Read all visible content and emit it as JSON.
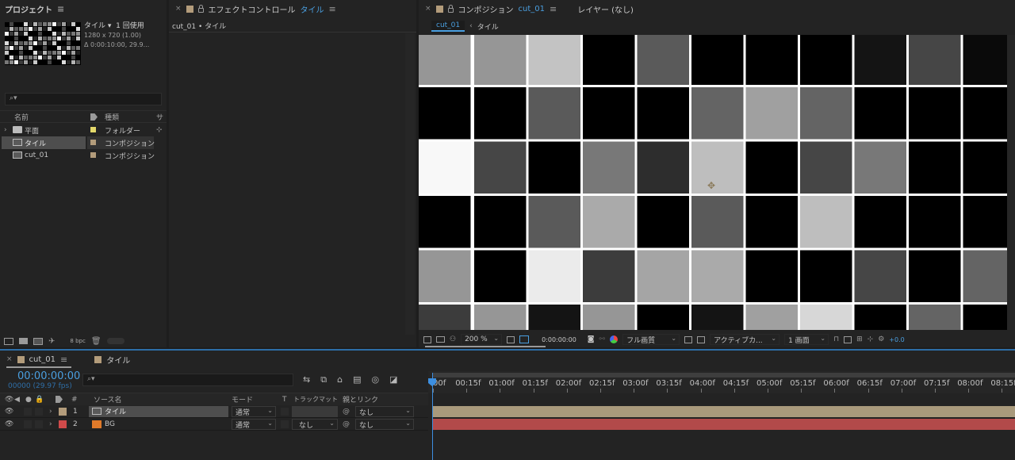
{
  "project": {
    "title": "プロジェクト",
    "item_name": "タイル ▾",
    "usage": "1 回使用",
    "resolution": "1280 x 720 (1.00)",
    "duration": "Δ 0:00:10:00, 29.9...",
    "columns": {
      "name": "名前",
      "type": "種類",
      "size": "サ"
    },
    "items": [
      {
        "name": "平面",
        "type": "フォルダー",
        "color": "#e3d86a",
        "icon": "folder-icon"
      },
      {
        "name": "タイル",
        "type": "コンポジション",
        "color": "#b39c7b",
        "icon": "composition-icon"
      },
      {
        "name": "cut_01",
        "type": "コンポジション",
        "color": "#b39c7b",
        "icon": "composition-icon"
      }
    ],
    "bpc": "8 bpc"
  },
  "effects": {
    "tab_prefix": "エフェクトコントロール",
    "tab_target": "タイル",
    "breadcrumb": "cut_01 • タイル"
  },
  "composition": {
    "tab_prefix": "コンポジション",
    "tab_target": "cut_01",
    "layer_tab": "レイヤー (なし)",
    "crumbs": [
      "cut_01",
      "タイル"
    ],
    "zoom": "200 %",
    "timecode": "0:00:00:00",
    "quality": "フル画質",
    "camera": "アクティブカ...",
    "views": "1 画面",
    "exposure": "+0.0",
    "grid_grays": [
      [
        150,
        150,
        195,
        0,
        90,
        0,
        0,
        0,
        20,
        70,
        10
      ],
      [
        0,
        0,
        90,
        0,
        0,
        100,
        160,
        100,
        0,
        0,
        0
      ],
      [
        248,
        70,
        0,
        120,
        45,
        190,
        0,
        70,
        120,
        0,
        0
      ],
      [
        0,
        0,
        90,
        170,
        0,
        90,
        0,
        190,
        0,
        0,
        0
      ],
      [
        150,
        0,
        235,
        60,
        165,
        170,
        0,
        0,
        70,
        0,
        100
      ],
      [
        60,
        150,
        20,
        150,
        0,
        20,
        160,
        215,
        0,
        100,
        0
      ]
    ]
  },
  "timeline": {
    "tabs": [
      "cut_01",
      "タイル"
    ],
    "timecode": "00:00:00:00",
    "fps": "00000 (29.97 fps)",
    "columns": {
      "source": "ソース名",
      "mode": "モード",
      "t": "T",
      "trackmatte": "トラックマット",
      "parent": "親とリンク"
    },
    "ruler": [
      "00f",
      "00:15f",
      "01:00f",
      "01:15f",
      "02:00f",
      "02:15f",
      "03:00f",
      "03:15f",
      "04:00f",
      "04:15f",
      "05:00f",
      "05:15f",
      "06:00f",
      "06:15f",
      "07:00f",
      "07:15f",
      "08:00f",
      "08:15f"
    ],
    "layers": [
      {
        "num": "1",
        "name": "タイル",
        "label_color": "#b39c7b",
        "mode": "通常",
        "trackmatte": "",
        "parent": "なし",
        "bar_color": "#a99a7c"
      },
      {
        "num": "2",
        "name": "BG",
        "label_color": "#d04a4a",
        "mode": "通常",
        "trackmatte": "なし",
        "parent": "なし",
        "bar_color": "#b24a4a"
      }
    ]
  }
}
